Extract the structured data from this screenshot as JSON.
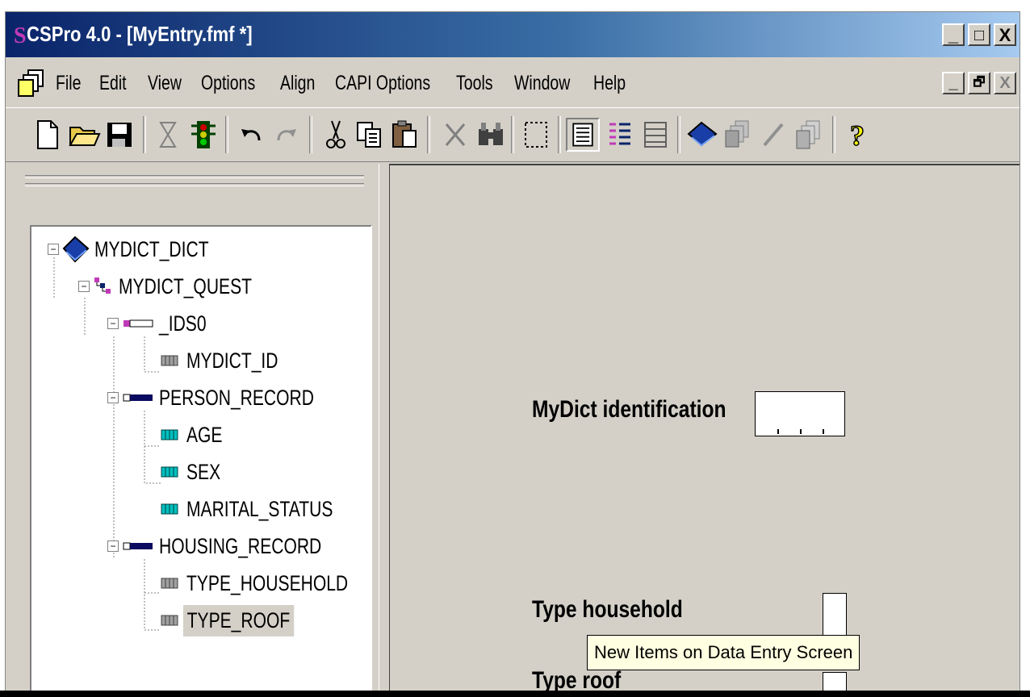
{
  "window": {
    "app_logo": "S",
    "title": "CSPro 4.0 - [MyEntry.fmf *]",
    "caption_buttons": [
      "_",
      "□",
      "X"
    ],
    "mdi_buttons": [
      "_",
      "🗗",
      "X"
    ]
  },
  "menu": {
    "items": [
      "File",
      "Edit",
      "View",
      "Options",
      "Align",
      "CAPI Options",
      "Tools",
      "Window",
      "Help"
    ]
  },
  "toolbar": {
    "icons": [
      "new-icon",
      "open-icon",
      "save-icon",
      "hourglass-icon",
      "traffic-light-icon",
      "undo-icon",
      "redo-icon",
      "cut-icon",
      "copy-icon",
      "paste-icon",
      "delete-icon",
      "find-icon",
      "select-box-icon",
      "tree-view-icon",
      "tree-list-icon",
      "roster-icon",
      "dictionary-icon",
      "forms-icon",
      "pencil-icon",
      "pages-icon",
      "help-icon"
    ]
  },
  "tree": {
    "root": "MYDICT_DICT",
    "level": "MYDICT_QUEST",
    "id_record": "_IDS0",
    "id_item": "MYDICT_ID",
    "person_record": "PERSON_RECORD",
    "person_items": [
      "AGE",
      "SEX",
      "MARITAL_STATUS"
    ],
    "housing_record": "HOUSING_RECORD",
    "housing_items": [
      "TYPE_HOUSEHOLD",
      "TYPE_ROOF"
    ],
    "selected": "TYPE_ROOF"
  },
  "form": {
    "id_label": "MyDict identification",
    "household_label": "Type household",
    "roof_label": "Type roof"
  },
  "tooltip": "New Items on Data Entry Screen",
  "colors": {
    "title_gradient_start": "#0a246a",
    "title_gradient_end": "#a6caf0",
    "face": "#d4d0c8",
    "tooltip_bg": "#ffffe1"
  }
}
